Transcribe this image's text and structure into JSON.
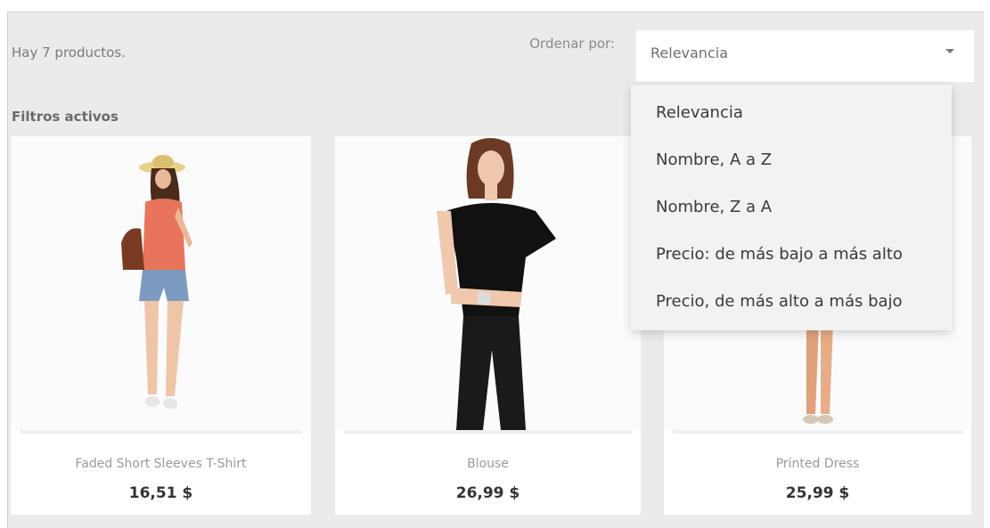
{
  "summary": {
    "product_count_text": "Hay 7 productos."
  },
  "sort": {
    "label": "Ordenar por:",
    "selected": "Relevancia",
    "options": [
      "Relevancia",
      "Nombre, A a Z",
      "Nombre, Z a A",
      "Precio: de más bajo a más alto",
      "Precio, de más alto a más bajo"
    ]
  },
  "filters": {
    "title": "Filtros activos"
  },
  "products": [
    {
      "name": "Faded Short Sleeves T-Shirt",
      "price": "16,51 $"
    },
    {
      "name": "Blouse",
      "price": "26,99 $"
    },
    {
      "name": "Printed Dress",
      "price": "25,99 $"
    }
  ],
  "icons": {
    "sort_caret": "chevron-down-icon"
  }
}
